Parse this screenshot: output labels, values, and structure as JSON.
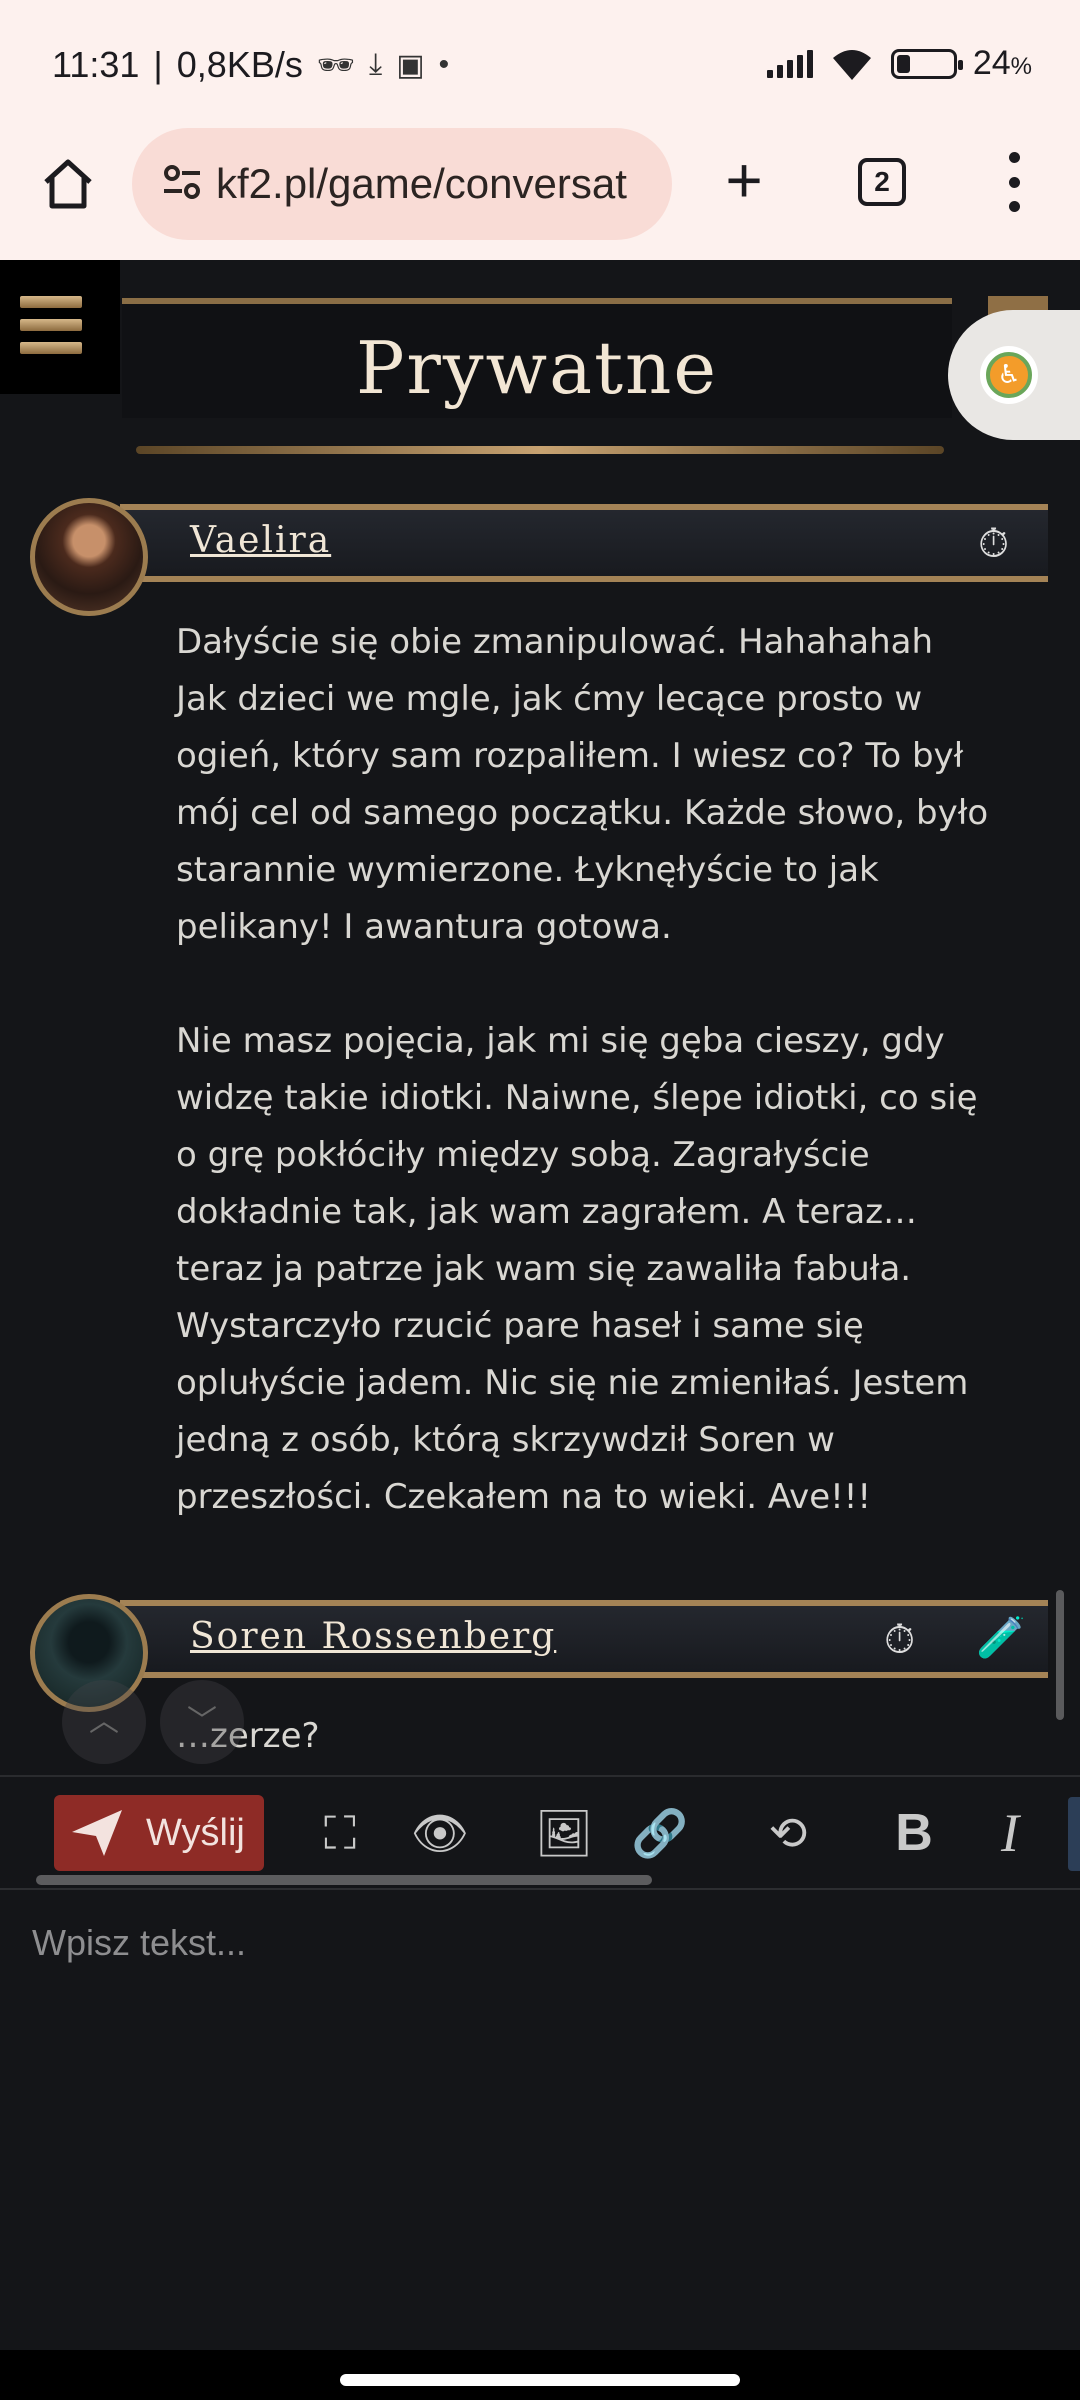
{
  "status_bar": {
    "time": "11:31",
    "separator": "|",
    "speed": "0,8KB/s",
    "dot": "•",
    "battery": "24",
    "battery_unit": "%"
  },
  "browser": {
    "url": "kf2.pl/game/conversat",
    "tab_count": "2"
  },
  "page": {
    "title": "Prywatne"
  },
  "messages": [
    {
      "author": "Vaelira",
      "text": "Dałyście się obie zmanipulować. Hahahahah\nJak dzieci we mgle, jak ćmy lecące prosto w\nogień, który sam rozpaliłem. I wiesz co? To był\nmój cel od samego początku. Każde słowo, było\nstarannie wymierzone. Łyknęłyście to jak\npelikany! I awantura gotowa.\n\nNie masz pojęcia, jak mi się gęba cieszy, gdy\nwidzę takie idiotki. Naiwne, ślepe idiotki, co się\no grę pokłóciły między sobą. Zagrałyście\ndokładnie tak, jak wam zagrałem. A teraz…\nteraz ja patrze jak wam się zawaliła fabuła.\nWystarczyło rzucić pare haseł i same się\noplułyście jadem. Nic się nie zmieniłaś. Jestem\njedną z osób, którą skrzywdził Soren w\nprzeszłości. Czekałem na to wieki. Ave!!!"
    },
    {
      "author": "Soren Rossenberg",
      "text": "…zerze?"
    }
  ],
  "toolbar": {
    "send_label": "Wyślij",
    "bold_label": "B",
    "italic_label": "I"
  },
  "editor": {
    "placeholder": "Wpisz tekst..."
  }
}
